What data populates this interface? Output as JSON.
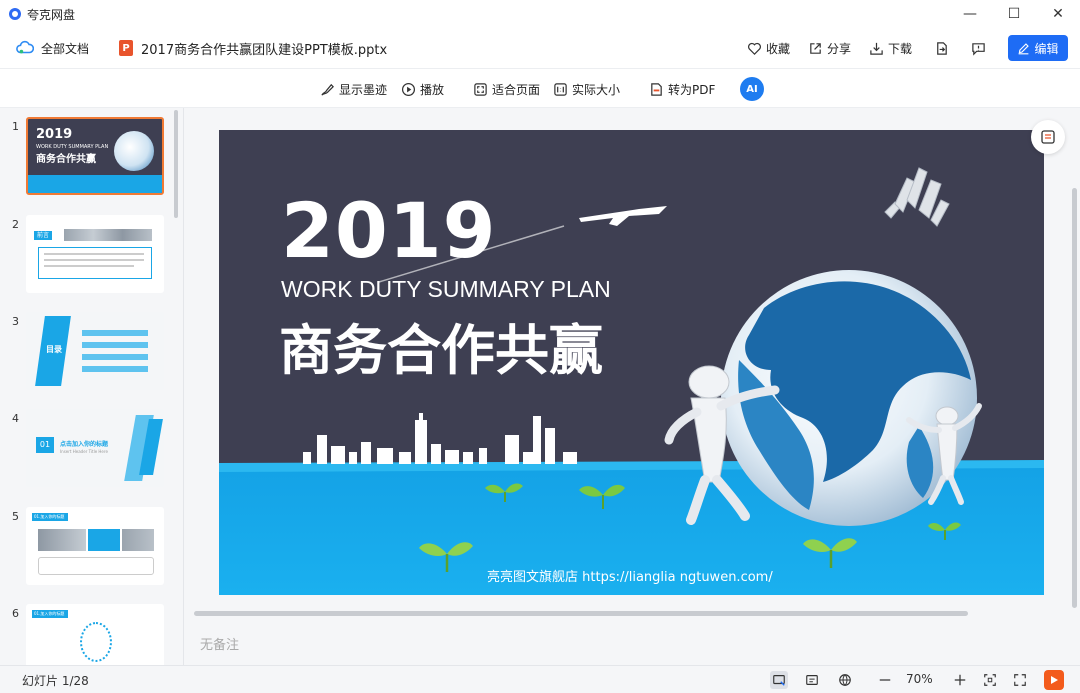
{
  "app": {
    "title": "夸克网盘"
  },
  "window_controls": {
    "minimize": "—",
    "maximize": "☐",
    "close": "✕"
  },
  "header": {
    "all_docs": "全部文档",
    "file_icon_letter": "P",
    "file_name": "2017商务合作共赢团队建设PPT模板.pptx",
    "favorite": "收藏",
    "share": "分享",
    "download": "下载",
    "edit": "编辑"
  },
  "toolbar": {
    "show_ink": "显示墨迹",
    "play": "播放",
    "fit_page": "适合页面",
    "actual_size": "实际大小",
    "to_pdf": "转为PDF",
    "ai_label": "AI"
  },
  "sidebar": {
    "thumbnails": [
      {
        "num": "1",
        "title_year": "2019",
        "title_en": "WORK DUTY SUMMARY PLAN",
        "title_cn": "商务合作共赢"
      },
      {
        "num": "2",
        "tag": "前言"
      },
      {
        "num": "3",
        "tag": "目录"
      },
      {
        "num": "4",
        "badge": "01",
        "heading": "点击加入你的标题",
        "subheading": "Insert Header Title Here"
      },
      {
        "num": "5",
        "tag": "01.加入你的标题"
      },
      {
        "num": "6",
        "tag": "01.加入你的标题"
      }
    ]
  },
  "slide": {
    "year": "2019",
    "subtitle": "WORK DUTY SUMMARY PLAN",
    "title_cn": "商务合作共赢",
    "footer": "亮亮图文旗舰店  https://lianglia ngtuwen.com/"
  },
  "notes": {
    "placeholder": "无备注"
  },
  "status": {
    "slide_count": "幻灯片 1/28",
    "zoom": "70%"
  },
  "colors": {
    "accent": "#1e6cf5",
    "slide_bg": "#3e3f52",
    "ground": "#1aa6e6",
    "active_thumb_border": "#f07a35"
  }
}
